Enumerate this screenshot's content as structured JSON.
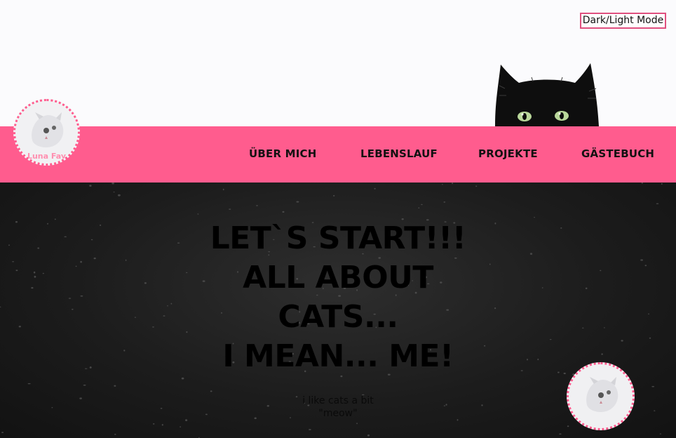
{
  "header": {
    "mode_toggle_label": "Dark/Light Mode"
  },
  "logo": {
    "name": "Luna Fay",
    "icon": "white-kitten-icon"
  },
  "nav": {
    "items": [
      {
        "label": "ÜBER MICH"
      },
      {
        "label": "LEBENSLAUF"
      },
      {
        "label": "PROJEKTE"
      },
      {
        "label": "GÄSTEBUCH"
      }
    ]
  },
  "hero": {
    "title_lines": [
      "LET`S START!!!",
      "ALL ABOUT",
      "CATS...",
      "I MEAN... ME!"
    ],
    "subtitle_lines": [
      "i like cats a bit",
      "\"meow\""
    ]
  },
  "colors": {
    "accent": "#ff5c8e",
    "hero_bg": "#1c1c1c",
    "top_bg": "#fbfbfd"
  }
}
